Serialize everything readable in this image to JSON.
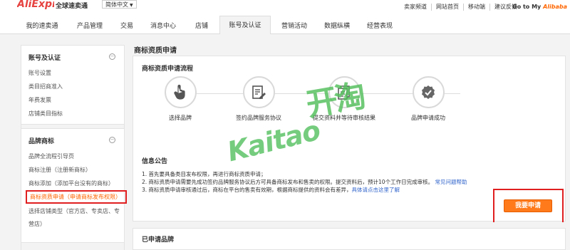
{
  "topbar": {
    "logo": "AliExpress",
    "logo_sub": "全球速卖通",
    "language": "简体中文",
    "links": [
      "卖家频道",
      "网站首页",
      "移动端",
      "建议反馈"
    ],
    "goto_prefix": "Go to My",
    "goto_brand": "Alibaba"
  },
  "nav": {
    "tabs": [
      "我的速卖通",
      "产品管理",
      "交易",
      "消息中心",
      "店铺",
      "账号及认证",
      "营销活动",
      "数据纵横",
      "经营表现"
    ],
    "active_tab": "账号及认证"
  },
  "sidebar": {
    "group1": {
      "title": "账号及认证",
      "toggle": "−",
      "items": [
        "账号设置",
        "类目招商准入",
        "年费发票",
        "店铺类目指标"
      ]
    },
    "group2": {
      "title": "品牌商标",
      "toggle": "−",
      "items": [
        "品牌全流程引导页",
        "商标注册（注册新商标）",
        "商标添加（添加平台没有的商标）",
        "商标资质申请（申请商标发布权限）",
        "选择店铺类型（官方店、专卖店、专",
        "营店）"
      ],
      "active_item": "商标资质申请（申请商标发布权限）"
    }
  },
  "main": {
    "page_title": "商标资质申请",
    "flow_title": "商标资质申请流程",
    "steps": [
      {
        "label": "选择品牌",
        "icon": "pointer-hand-icon"
      },
      {
        "label": "签约品牌服务协议",
        "icon": "edit-document-icon"
      },
      {
        "label": "提交资料并等待审核结果",
        "icon": "documents-icon"
      },
      {
        "label": "品牌申请成功",
        "icon": "approved-badge-icon"
      }
    ],
    "notice_title": "信息公告",
    "notices": [
      {
        "text": "1. 首先要具备类目发布权限，再进行商标资质申请；",
        "link": ""
      },
      {
        "text": "2. 商标资质申请需要先成功签约品牌服务协议后方可具备商标发布和售卖的权限。提交资料后，预计10个工作日完成审核。常见问题帮助",
        "link": "常见问题帮助"
      },
      {
        "text": "3. 商标资质申请审核通过后，商标在平台的售卖有效期，根据商标提供的资料会有差异，",
        "link": "具体请点击这里了解"
      }
    ],
    "apply_button": "我要申请",
    "applied_title": "已申请品牌"
  },
  "watermark": {
    "latin": "Kaitao",
    "chinese": "开淘"
  },
  "colors": {
    "accent": "#ff7a1a",
    "highlight_border": "#e02020",
    "link": "#3366cc",
    "watermark": "#50be5a"
  }
}
